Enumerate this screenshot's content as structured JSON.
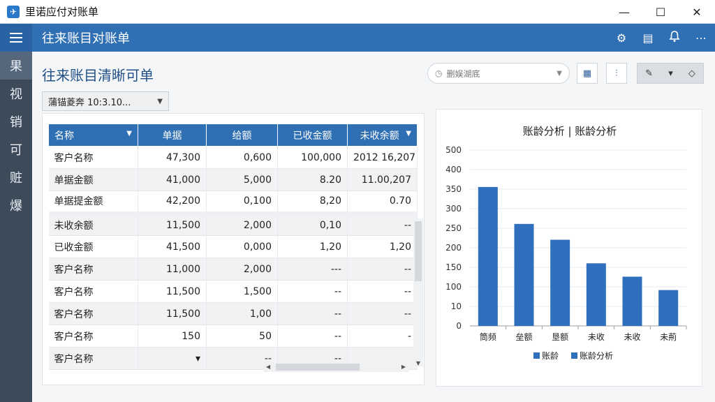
{
  "window": {
    "title": "里诺应付对账单",
    "minimize": "—",
    "maximize": "☐",
    "close": "✕"
  },
  "appbar": {
    "title": "往来账目对账单"
  },
  "sidebar": {
    "items": [
      "果",
      "视",
      "销",
      "可",
      "赃",
      "爆"
    ]
  },
  "page": {
    "title": "往来账目清晰可单",
    "search_placeholder": "删娱湖底",
    "period_label": "蒲锚菱奔  10:3.10..."
  },
  "table": {
    "columns": [
      "名称",
      "单据",
      "给额",
      "已收金额",
      "未收余额"
    ],
    "rows": [
      [
        "客户名称",
        "47,300",
        "0,600",
        "100,000",
        "2012 16,207"
      ],
      [
        "单据金额",
        "41,000",
        "5,000",
        "8.20",
        "11.00,207"
      ],
      [
        "单据提金额",
        "42,200",
        "0,100",
        "8,20",
        "0.70"
      ],
      [
        "未收余额",
        "11,500",
        "2,000",
        "0,10",
        "--"
      ],
      [
        "已收金额",
        "41,500",
        "0,000",
        "1,20",
        "1,20"
      ],
      [
        "客户名称",
        "11,000",
        "2,000",
        "---",
        "--"
      ],
      [
        "客户名称",
        "11,500",
        "1,500",
        "--",
        "--"
      ],
      [
        "客户名称",
        "11,500",
        "1,00",
        "--",
        "--"
      ],
      [
        "客户名称",
        "150",
        "50",
        "--",
        "-"
      ],
      [
        "客户名称",
        "▾",
        "--",
        "--",
        ""
      ]
    ]
  },
  "chart_data": {
    "type": "bar",
    "title": "账龄分析 | 账龄分析",
    "categories": [
      "筒频",
      "垒额",
      "垦额",
      "未收",
      "未收",
      "未荊"
    ],
    "values": [
      395,
      290,
      245,
      178,
      140,
      102
    ],
    "y_ticks": [
      "0",
      "10",
      "100",
      "150",
      "200",
      "250",
      "300",
      "350",
      "400",
      "500"
    ],
    "ylim": [
      0,
      500
    ],
    "legend": [
      "账龄",
      "账龄分析"
    ],
    "legend_position": "bottom",
    "bar_color": "#2e6fbe"
  }
}
